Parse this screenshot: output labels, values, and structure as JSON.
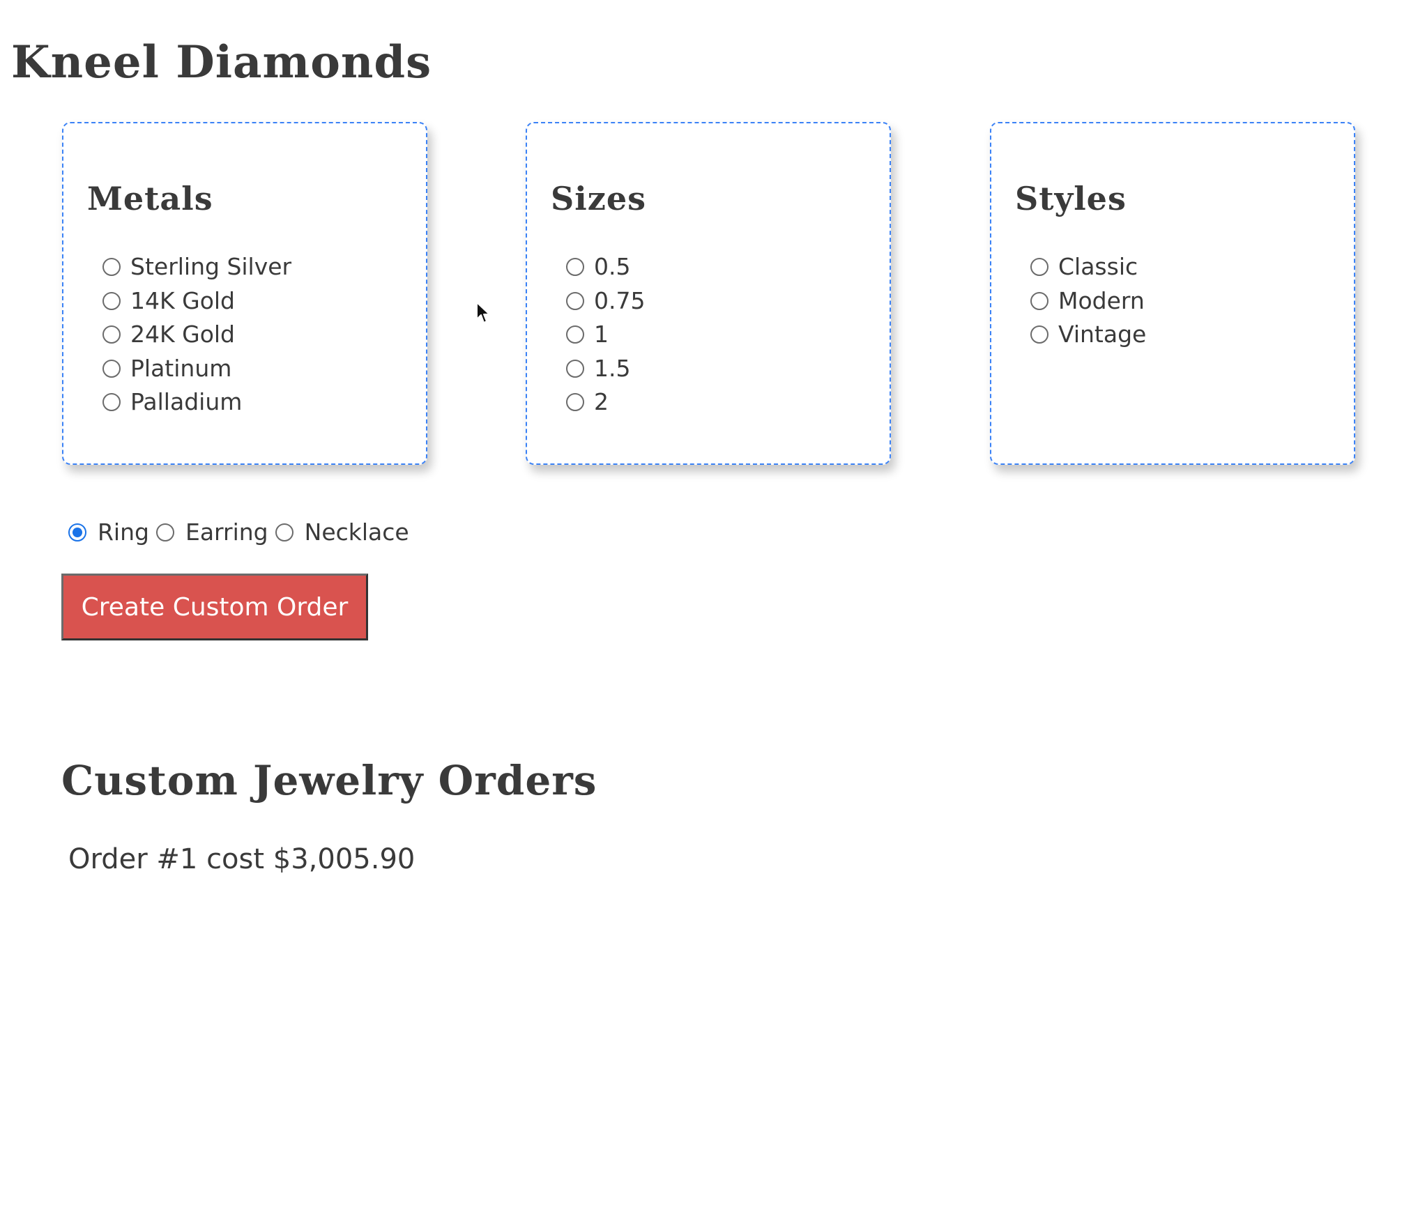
{
  "title": "Kneel Diamonds",
  "metals": {
    "heading": "Metals",
    "options": [
      "Sterling Silver",
      "14K Gold",
      "24K Gold",
      "Platinum",
      "Palladium"
    ]
  },
  "sizes": {
    "heading": "Sizes",
    "options": [
      "0.5",
      "0.75",
      "1",
      "1.5",
      "2"
    ]
  },
  "styles": {
    "heading": "Styles",
    "options": [
      "Classic",
      "Modern",
      "Vintage"
    ]
  },
  "types": {
    "options": [
      "Ring",
      "Earring",
      "Necklace"
    ],
    "selected": "Ring"
  },
  "create_button_label": "Create Custom Order",
  "orders": {
    "heading": "Custom Jewelry Orders",
    "items": [
      "Order #1 cost $3,005.90"
    ]
  },
  "colors": {
    "accent": "#1a73e8",
    "card_border": "#3b82f6",
    "button_bg": "#d9534f",
    "text": "#3a3a3a"
  }
}
